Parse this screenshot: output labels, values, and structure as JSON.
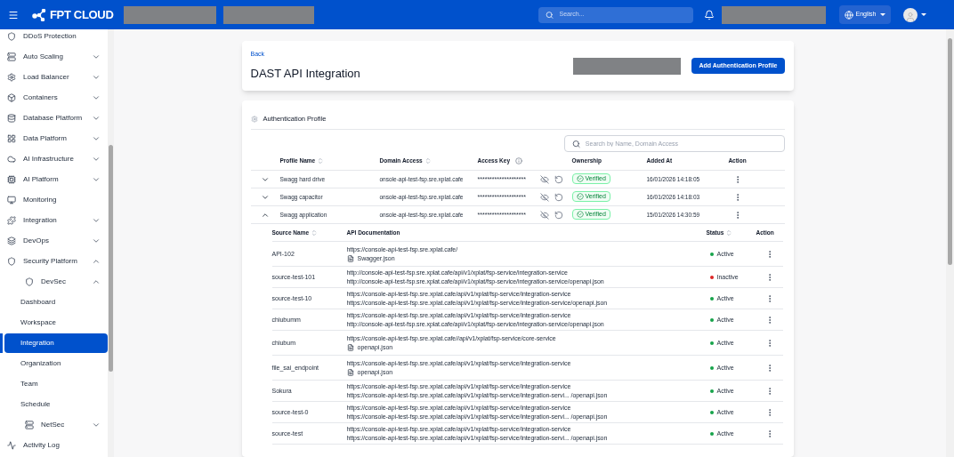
{
  "header": {
    "logo": "FPT CLOUD",
    "search": {
      "placeholder": "Search..."
    },
    "language": "English"
  },
  "sidebar": {
    "items": [
      {
        "label": "DDoS Protection"
      },
      {
        "label": "Auto Scaling",
        "expanded": false
      },
      {
        "label": "Load Balancer",
        "expanded": false
      },
      {
        "label": "Containers",
        "expanded": false
      },
      {
        "label": "Database Platform",
        "expanded": false
      },
      {
        "label": "Data Platform",
        "expanded": false
      },
      {
        "label": "AI Infrastructure",
        "expanded": false
      },
      {
        "label": "AI Platform",
        "expanded": false
      },
      {
        "label": "Monitoring"
      },
      {
        "label": "Integration",
        "expanded": false
      },
      {
        "label": "DevOps",
        "expanded": false
      },
      {
        "label": "Security Platform",
        "expanded": true,
        "children": [
          {
            "label": "DevSec",
            "expanded": true,
            "children": [
              {
                "label": "Dashboard",
                "selected": false
              },
              {
                "label": "Workspace",
                "selected": false
              },
              {
                "label": "Integration",
                "selected": true
              },
              {
                "label": "Organization",
                "selected": false
              },
              {
                "label": "Team",
                "selected": false
              },
              {
                "label": "Schedule",
                "selected": false
              }
            ]
          },
          {
            "label": "NetSec",
            "expanded": false
          }
        ]
      },
      {
        "label": "Activity Log"
      }
    ]
  },
  "page": {
    "back": "Back",
    "title": "DAST API Integration",
    "add_button": "Add Authentication Profile"
  },
  "section": {
    "title": "Authentication Profile",
    "search": {
      "placeholder": "Search by Name, Domain Access"
    },
    "columns": [
      "Profile Name",
      "Domain Access",
      "Access Key",
      "Ownership",
      "Added At",
      "Action"
    ],
    "profiles": [
      {
        "name": "Swagg hard drive",
        "domain": "onsole-api-test-fsp.sre.xplat.cafe",
        "key": "********************",
        "ownership": "Verified",
        "added": "16/01/2026 14:18:05",
        "expanded": false
      },
      {
        "name": "Swagg capacitor",
        "domain": "onsole-api-test-fsp.sre.xplat.cafe",
        "key": "********************",
        "ownership": "Verified",
        "added": "16/01/2026 14:18:03",
        "expanded": false
      },
      {
        "name": "Swagg application",
        "domain": "onsole-api-test-fsp.sre.xplat.cafe",
        "key": "********************",
        "ownership": "Verified",
        "added": "15/01/2026 14:30:59",
        "expanded": true
      }
    ],
    "sources": {
      "columns": [
        "Source Name",
        "API Documentation",
        "Status",
        "Action"
      ],
      "rows": [
        {
          "name": "API-102",
          "url": "https://console-api-test-fsp.sre.xplat.cafe/",
          "doc": {
            "kind": "file",
            "text": "Swagger.json"
          },
          "status": "Active",
          "color": "#16a34a"
        },
        {
          "name": "source-test-101",
          "url": "http://console-api-test-fsp.sre.xplat.cafe/api/v1/xplat/fsp-service/integration-service",
          "doc": {
            "kind": "url",
            "text": "http://console-api-test-fsp.sre.xplat.cafe/api/v1/xplat/fsp-service/integration-service/openapi.json"
          },
          "status": "Inactive",
          "color": "#dc2626"
        },
        {
          "name": "source-test-10",
          "url": "https://console-api-test-fsp.sre.xplat.cafe/api/v1/xplat/fsp-service/integration-service",
          "doc": {
            "kind": "url",
            "text": "https://console-api-test-fsp.sre.xplat.cafe/api/v1/xplat/fsp-service/integration-service/openapi.json"
          },
          "status": "Active",
          "color": "#16a34a"
        },
        {
          "name": "chiubumm",
          "url": "https://console-api-test-fsp.sre.xplat.cafe/api/v1/xplat/fsp-service/integration-service",
          "doc": {
            "kind": "url",
            "text": "http://console-api-test-fsp.sre.xplat.cafe/api/v1/xplat/fsp-service/integration-service/openapi.json"
          },
          "status": "Active",
          "color": "#16a34a"
        },
        {
          "name": "chiubum",
          "url": "https://console-api-test-fsp.sre.xplat.cafe//api/v1/xplat/fsp-service/core-service",
          "doc": {
            "kind": "file",
            "text": "openapi.json"
          },
          "status": "Active",
          "color": "#16a34a"
        },
        {
          "name": "file_sai_endpoint",
          "url": "https://console-api-test-fsp.sre.xplat.cafe/api/v1/xplat/fsp-service/integration-service",
          "doc": {
            "kind": "file",
            "text": "openapi.json"
          },
          "status": "Active",
          "color": "#16a34a"
        },
        {
          "name": "Sokura",
          "url": "https://console-api-test-fsp.sre.xplat.cafe/api/v1/xplat/fsp-service/integration-service",
          "doc": {
            "kind": "url",
            "text": "https://console-api-test-fsp.sre.xplat.cafe/api/v1/xplat/fsp-service/integration-servi... /openapi.json"
          },
          "status": "Active",
          "color": "#16a34a"
        },
        {
          "name": "source-test-0",
          "url": "https://console-api-test-fsp.sre.xplat.cafe/api/v1/xplat/fsp-service/integration-service",
          "doc": {
            "kind": "url",
            "text": "https://console-api-test-fsp.sre.xplat.cafe/api/v1/xplat/fsp-service/integration-servi... /openapi.json"
          },
          "status": "Active",
          "color": "#16a34a"
        },
        {
          "name": "source-test",
          "url": "https://console-api-test-fsp.sre.xplat.cafe/api/v1/xplat/fsp-service/integration-service",
          "doc": {
            "kind": "url",
            "text": "https://console-api-test-fsp.sre.xplat.cafe/api/v1/xplat/fsp-service/integration-servi... /openapi.json"
          },
          "status": "Active",
          "color": "#16a34a"
        }
      ]
    }
  }
}
